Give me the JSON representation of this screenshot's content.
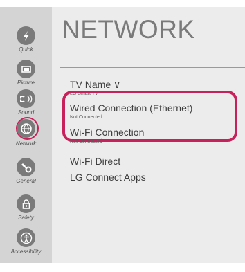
{
  "sidebar": {
    "items": [
      {
        "label": "Quick",
        "icon": "quick-icon"
      },
      {
        "label": "Picture",
        "icon": "picture-icon"
      },
      {
        "label": "Sound",
        "icon": "sound-icon"
      },
      {
        "label": "Network",
        "icon": "network-icon",
        "active": true
      },
      {
        "label": "General",
        "icon": "general-icon"
      },
      {
        "label": "Safety",
        "icon": "lock-icon"
      },
      {
        "label": "Accessibility",
        "icon": "accessibility-icon"
      }
    ]
  },
  "main": {
    "title": "NETWORK",
    "items": [
      {
        "label": "TV Name ∨",
        "sub": "LG Smart TV"
      },
      {
        "label": "Wired Connection (Ethernet)",
        "sub": "Not Connected"
      },
      {
        "label": "Wi-Fi Connection",
        "sub": "Not Connected"
      },
      {
        "label": "Wi-Fi Direct"
      },
      {
        "label": "LG Connect Apps"
      }
    ]
  },
  "colors": {
    "highlight": "#c8205a",
    "icon_circle": "#7a7a7a",
    "sidebar_bg": "#d4d4d4",
    "main_bg": "#ececec"
  }
}
